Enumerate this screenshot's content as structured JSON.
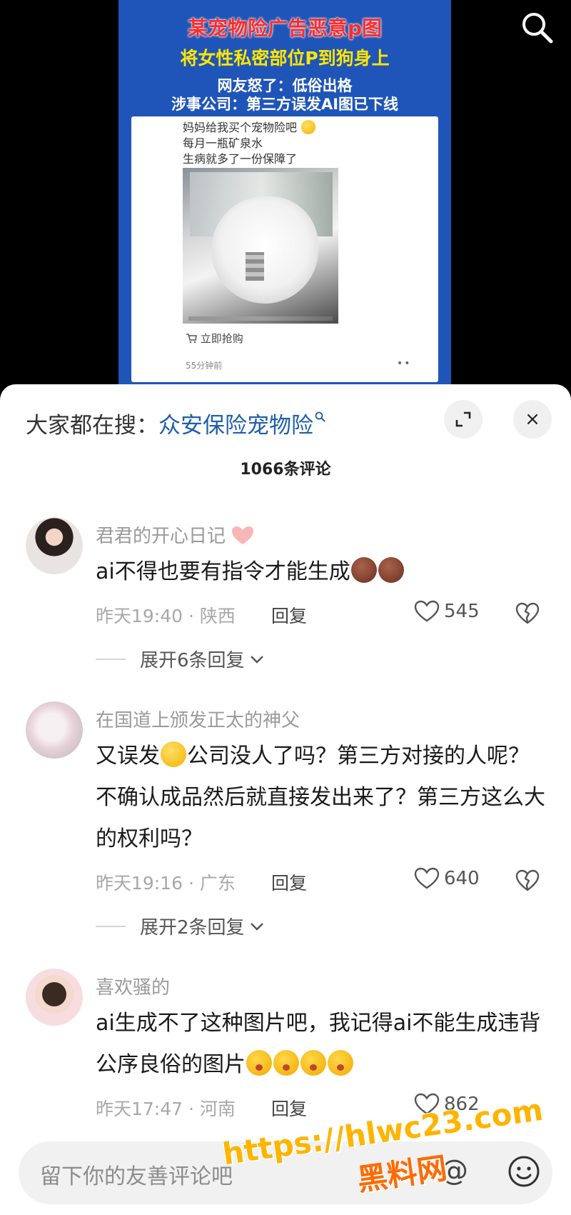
{
  "video": {
    "headline1": "某宠物险广告恶意p图",
    "headline2": "将女性私密部位P到狗身上",
    "headline3": "网友怒了：低俗出格",
    "headline4": "涉事公司：第三方误发AI图已下线",
    "card_line1": "妈妈给我买个宠物险吧",
    "card_line2": "每月一瓶矿泉水",
    "card_line3": "生病就多了一份保障了",
    "buy_label": "立即抢购",
    "time_ago": "55分钟前",
    "more_label": "••"
  },
  "top_search_icon": "search-icon",
  "sheet": {
    "trend_prefix": "大家都在搜：",
    "trend_link": "众安保险宠物险",
    "comment_count": "1066条评论",
    "expand_icon": "expand-icon",
    "close_label": "×"
  },
  "comments": [
    {
      "user": "君君的开心日记",
      "text": "ai不得也要有指令才能生成",
      "time": "昨天19:40 · 陕西",
      "reply_label": "回复",
      "likes": "545",
      "expand": "展开6条回复"
    },
    {
      "user": "在国道上颁发正太的神父",
      "text_before_emoji": "又误发",
      "text_after_emoji": "公司没人了吗？第三方对接的人呢？不确认成品然后就直接发出来了？第三方这么大的权利吗？",
      "time": "昨天19:16 · 广东",
      "reply_label": "回复",
      "likes": "640",
      "expand": "展开2条回复"
    },
    {
      "user": "喜欢骚的",
      "text": "ai生成不了这种图片吧，我记得ai不能生成违背公序良俗的图片",
      "time": "昨天17:47 · 河南",
      "reply_label": "回复",
      "likes": "862"
    }
  ],
  "input": {
    "placeholder": "留下你的友善评论吧",
    "at_label": "@"
  },
  "watermark": {
    "line1": "https://hlwc23.com",
    "line2": "黑料网"
  },
  "colors": {
    "poster_bg": "#1f55b8",
    "headline_red": "#ff2b2b",
    "headline_yellow": "#ffe600",
    "link_blue": "#1e5faa",
    "watermark_orange": "#ffb400"
  }
}
